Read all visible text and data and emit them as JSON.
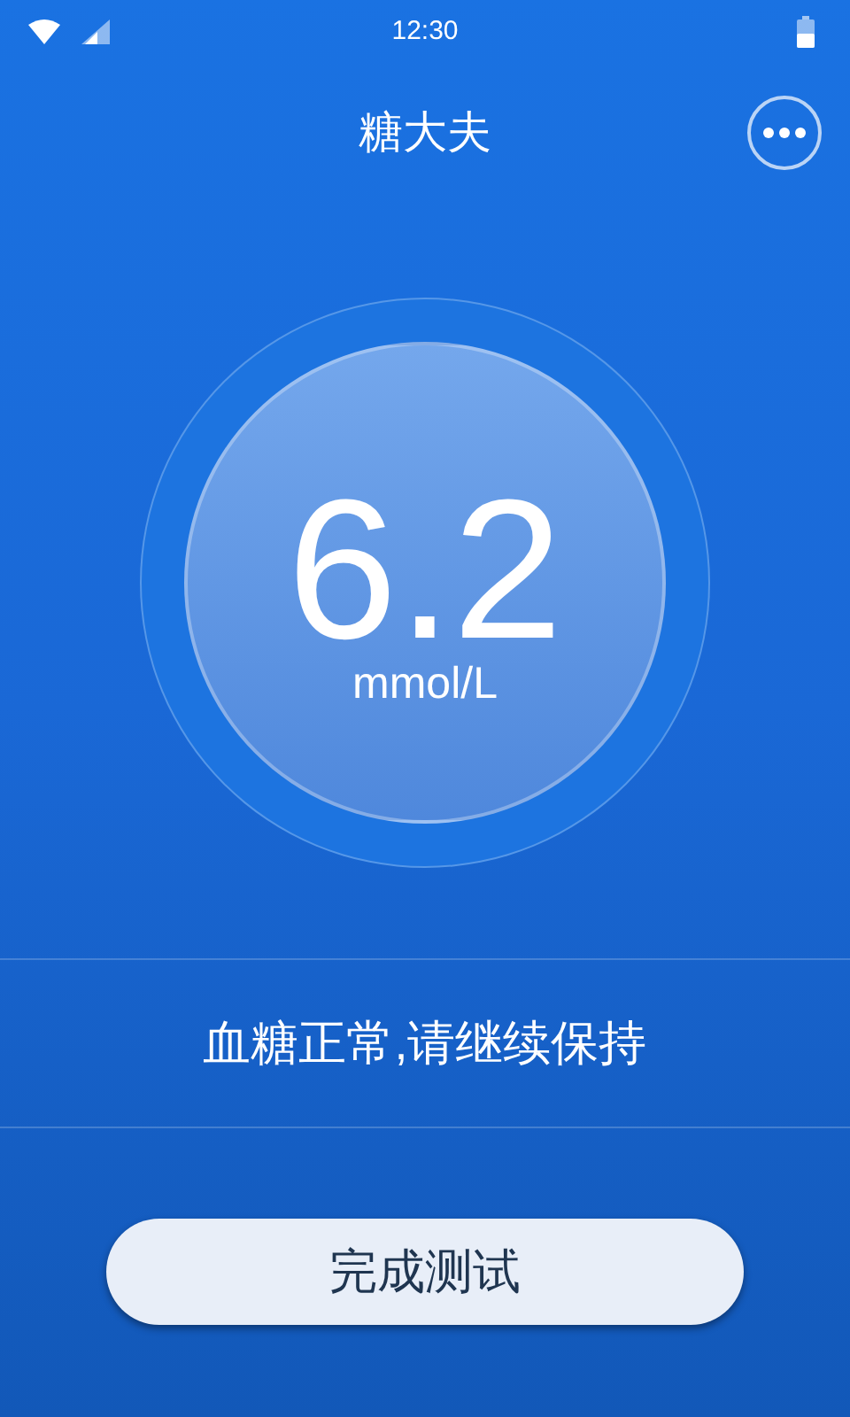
{
  "status_bar": {
    "time": "12:30"
  },
  "header": {
    "title": "糖大夫"
  },
  "reading": {
    "value": "6.2",
    "unit": "mmol/L"
  },
  "message": "血糖正常,请继续保持",
  "action_button": {
    "label": "完成测试"
  }
}
